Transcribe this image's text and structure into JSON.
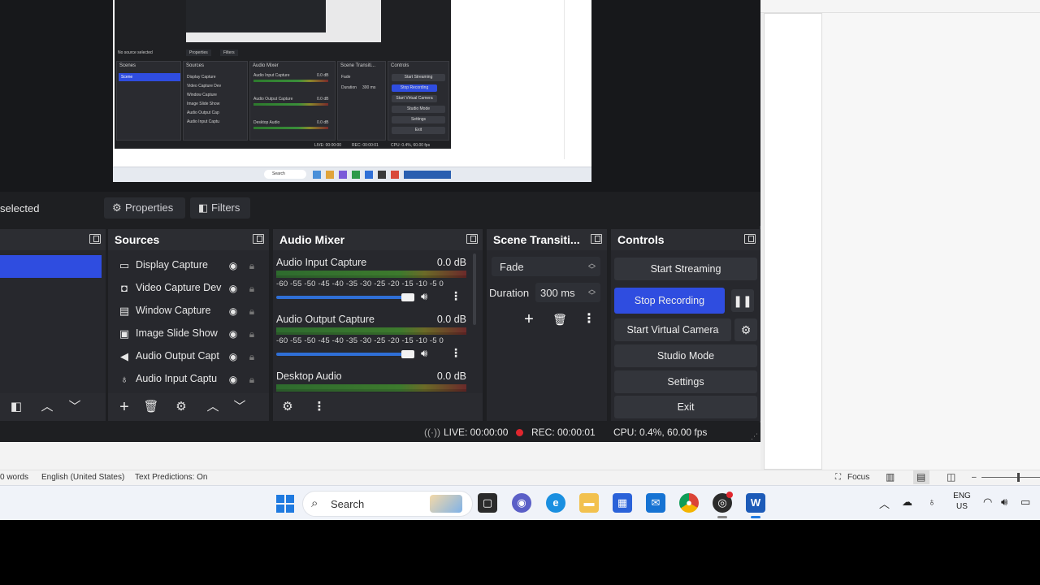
{
  "properties_bar": {
    "selected_text": "selected",
    "properties_label": "Properties",
    "filters_label": "Filters"
  },
  "docks": {
    "scenes": {
      "title": ""
    },
    "sources": {
      "title": "Sources",
      "items": [
        {
          "label": "Display Capture",
          "icon": "monitor-icon"
        },
        {
          "label": "Video Capture Dev",
          "icon": "camera-icon"
        },
        {
          "label": "Window Capture",
          "icon": "window-icon"
        },
        {
          "label": "Image Slide Show",
          "icon": "slideshow-icon"
        },
        {
          "label": "Audio Output Capt",
          "icon": "speaker-icon"
        },
        {
          "label": "Audio Input Captu",
          "icon": "microphone-icon"
        }
      ]
    },
    "mixer": {
      "title": "Audio Mixer",
      "scale": "-60 -55 -50 -45 -40 -35 -30 -25 -20 -15 -10 -5 0",
      "channels": [
        {
          "name": "Audio Input Capture",
          "db": "0.0 dB"
        },
        {
          "name": "Audio Output Capture",
          "db": "0.0 dB"
        },
        {
          "name": "Desktop Audio",
          "db": "0.0 dB"
        }
      ]
    },
    "transitions": {
      "title": "Scene Transiti...",
      "selected": "Fade",
      "duration_label": "Duration",
      "duration_value": "300 ms"
    },
    "controls": {
      "title": "Controls",
      "start_streaming": "Start Streaming",
      "stop_recording": "Stop Recording",
      "start_virtual_camera": "Start Virtual Camera",
      "studio_mode": "Studio Mode",
      "settings": "Settings",
      "exit": "Exit"
    }
  },
  "status": {
    "live": "LIVE: 00:00:00",
    "rec": "REC: 00:00:01",
    "cpu": "CPU: 0.4%, 60.00 fps"
  },
  "word_status": {
    "words": "0 words",
    "language": "English (United States)",
    "predictions": "Text Predictions: On",
    "focus": "Focus"
  },
  "taskbar": {
    "search_label": "Search",
    "lang_top": "ENG",
    "lang_bottom": "US"
  },
  "mini": {
    "no_source": "No source selected",
    "properties": "Properties",
    "filters": "Filters",
    "scenes": "Scenes",
    "sources": "Sources",
    "mixer": "Audio Mixer",
    "transitions": "Scene Transiti...",
    "controls": "Controls",
    "scene": "Scene",
    "src1": "Display Capture",
    "src2": "Video Capture Dev",
    "src3": "Window Capture",
    "src4": "Image Slide Show",
    "src5": "Audio Output Cap",
    "src6": "Audio Input Captu",
    "ch1": "Audio Input Capture",
    "ch2": "Audio Output Capture",
    "ch3": "Desktop Audio",
    "db": "0.0 dB",
    "fade": "Fade",
    "duration": "Duration",
    "duration_value": "300 ms",
    "start_streaming": "Start Streaming",
    "stop_recording": "Stop Recording",
    "start_virtual": "Start Virtual Camera",
    "studio_mode": "Studio Mode",
    "settings": "Settings",
    "exit": "Exit",
    "live": "LIVE: 00:00:00",
    "rec": "REC: 00:00:01",
    "cpu": "CPU: 0.4%, 60.00 fps",
    "search": "Search"
  },
  "colors": {
    "accent_blue": "#2f4de0",
    "rec_red": "#e0262e",
    "panel_bg": "#27282d"
  }
}
